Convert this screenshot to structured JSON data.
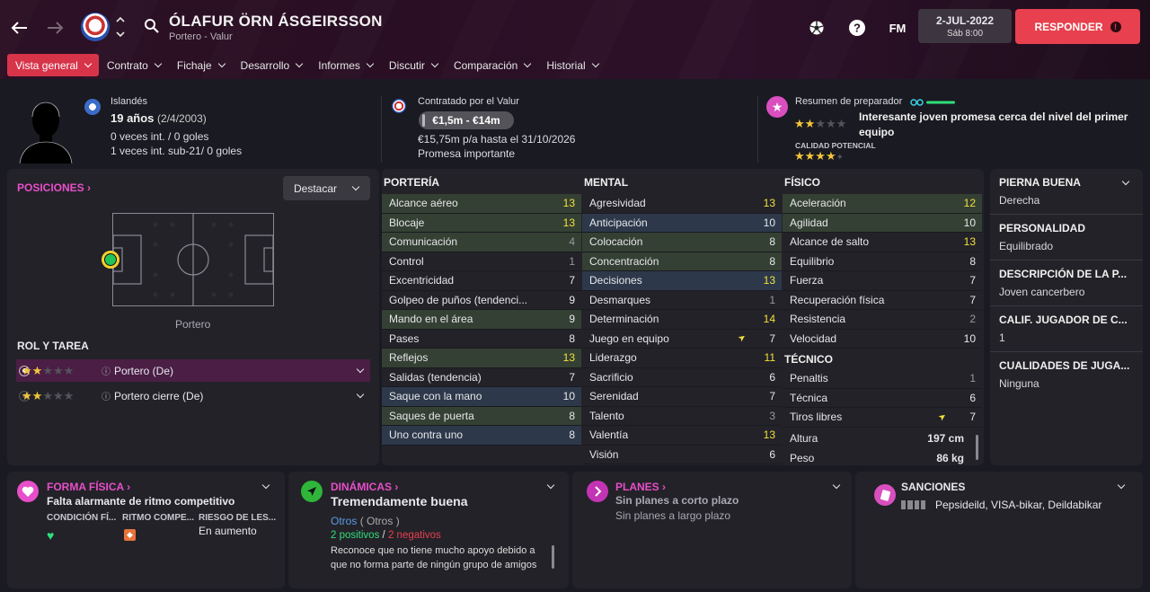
{
  "header": {
    "player_name": "ÓLAFUR ÖRN ÁSGEIRSSON",
    "subtitle": "Portero - Valur",
    "fm_label": "FM",
    "date": "2-JUL-2022",
    "time": "Sáb 8:00",
    "respond_label": "RESPONDER"
  },
  "tabs": [
    {
      "label": "Vista general"
    },
    {
      "label": "Contrato"
    },
    {
      "label": "Fichaje"
    },
    {
      "label": "Desarrollo"
    },
    {
      "label": "Informes"
    },
    {
      "label": "Discutir"
    },
    {
      "label": "Comparación"
    },
    {
      "label": "Historial"
    }
  ],
  "profile": {
    "nationality": "Islandés",
    "age": "19 años",
    "dob": "(2/4/2003)",
    "caps": "0 veces int. / 0 goles",
    "u21_caps": "1 veces int. sub-21/ 0 goles"
  },
  "contract": {
    "club_line": "Contratado por el Valur",
    "value": "€1,5m - €14m",
    "wage": "€15,75m p/a hasta el 31/10/2026",
    "status": "Promesa importante"
  },
  "coach": {
    "title": "Resumen de preparador",
    "summary": "Interesante joven promesa cerca del nivel del primer equipo",
    "potential_label": "CALIDAD POTENCIAL",
    "current_stars": 2,
    "potential_stars": 3.5
  },
  "positions": {
    "title": "POSICIONES",
    "highlight_label": "Destacar",
    "position_label": "Portero"
  },
  "roles": {
    "title": "ROL Y TAREA",
    "items": [
      {
        "label": "Portero (De)",
        "stars": 2
      },
      {
        "label": "Portero cierre (De)",
        "stars": 2
      }
    ]
  },
  "goalkeeping": {
    "title": "PORTERÍA",
    "attrs": [
      {
        "name": "Alcance aéreo",
        "value": "13"
      },
      {
        "name": "Blocaje",
        "value": "13"
      },
      {
        "name": "Comunicación",
        "value": "4"
      },
      {
        "name": "Control",
        "value": "1"
      },
      {
        "name": "Excentricidad",
        "value": "7"
      },
      {
        "name": "Golpeo de puños (tendenci...",
        "value": "9"
      },
      {
        "name": "Mando en el área",
        "value": "9"
      },
      {
        "name": "Pases",
        "value": "8"
      },
      {
        "name": "Reflejos",
        "value": "13"
      },
      {
        "name": "Salidas (tendencia)",
        "value": "7"
      },
      {
        "name": "Saque con la mano",
        "value": "10"
      },
      {
        "name": "Saques de puerta",
        "value": "8"
      },
      {
        "name": "Uno contra uno",
        "value": "8"
      }
    ]
  },
  "mental": {
    "title": "MENTAL",
    "attrs": [
      {
        "name": "Agresividad",
        "value": "13"
      },
      {
        "name": "Anticipación",
        "value": "10"
      },
      {
        "name": "Colocación",
        "value": "8"
      },
      {
        "name": "Concentración",
        "value": "8"
      },
      {
        "name": "Decisiones",
        "value": "13"
      },
      {
        "name": "Desmarques",
        "value": "1"
      },
      {
        "name": "Determinación",
        "value": "14"
      },
      {
        "name": "Juego en equipo",
        "value": "7"
      },
      {
        "name": "Liderazgo",
        "value": "11"
      },
      {
        "name": "Sacrificio",
        "value": "6"
      },
      {
        "name": "Serenidad",
        "value": "7"
      },
      {
        "name": "Talento",
        "value": "3"
      },
      {
        "name": "Valentía",
        "value": "13"
      },
      {
        "name": "Visión",
        "value": "6"
      }
    ]
  },
  "physical": {
    "title": "FÍSICO",
    "attrs": [
      {
        "name": "Aceleración",
        "value": "12"
      },
      {
        "name": "Agilidad",
        "value": "10"
      },
      {
        "name": "Alcance de salto",
        "value": "13"
      },
      {
        "name": "Equilibrio",
        "value": "8"
      },
      {
        "name": "Fuerza",
        "value": "7"
      },
      {
        "name": "Recuperación física",
        "value": "7"
      },
      {
        "name": "Resistencia",
        "value": "2"
      },
      {
        "name": "Velocidad",
        "value": "10"
      }
    ]
  },
  "technical": {
    "title": "TÉCNICO",
    "attrs": [
      {
        "name": "Penaltis",
        "value": "1"
      },
      {
        "name": "Técnica",
        "value": "6"
      },
      {
        "name": "Tiros libres",
        "value": "7"
      }
    ]
  },
  "body": {
    "height_label": "Altura",
    "height": "197 cm",
    "weight_label": "Peso",
    "weight": "86 kg"
  },
  "side": [
    {
      "title": "PIERNA BUENA",
      "value": "Derecha"
    },
    {
      "title": "PERSONALIDAD",
      "value": "Equilibrado"
    },
    {
      "title": "DESCRIPCIÓN DE LA P...",
      "value": "Joven cancerbero"
    },
    {
      "title": "CALIF. JUGADOR DE C...",
      "value": "1"
    },
    {
      "title": "CUALIDADES DE JUGA...",
      "value": "Ninguna"
    }
  ],
  "fitness": {
    "title": "FORMA FÍSICA",
    "headline": "Falta alarmante de ritmo competitivo",
    "col1": "CONDICIÓN FÍ...",
    "col2": "RITMO COMPE...",
    "col3": "RIESGO DE LES...",
    "col3_value": "En aumento"
  },
  "dynamics": {
    "title": "DINÁMICAS",
    "headline": "Tremendamente buena",
    "group": "Otros",
    "group_paren": "( Otros )",
    "positives": "2 positivos",
    "sep": "/",
    "negatives": "2 negativos",
    "text": "Reconoce que no tiene mucho apoyo debido a que no forma parte de ningún grupo de amigos dentro del vestuario"
  },
  "plans": {
    "title": "PLANES",
    "short": "Sin planes a corto plazo",
    "long": "Sin planes a largo plazo"
  },
  "sanctions": {
    "title": "SANCIONES",
    "text": "Pepsideild, VISA-bikar, Deildabikar"
  },
  "colors": {
    "accent_pink": "#e64fc9",
    "respond_red": "#e8404e",
    "highlight_green": "#344033",
    "highlight_blue": "#2d394a",
    "value_yellow": "#f2e23a"
  }
}
